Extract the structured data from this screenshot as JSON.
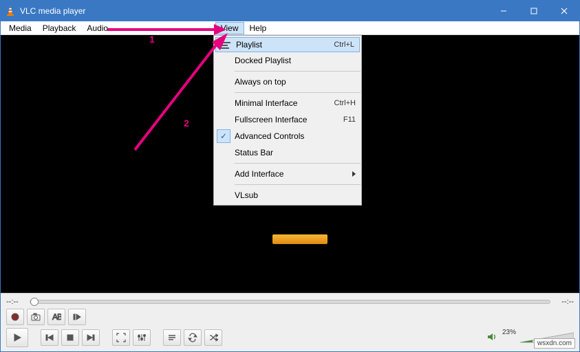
{
  "titlebar": {
    "title": "VLC media player"
  },
  "menu": {
    "media": "Media",
    "playback": "Playback",
    "audio": "Audio",
    "view": "View",
    "help": "Help"
  },
  "view_menu": {
    "playlist": "Playlist",
    "playlist_shortcut": "Ctrl+L",
    "docked_playlist": "Docked Playlist",
    "always_on_top": "Always on top",
    "minimal_interface": "Minimal Interface",
    "minimal_shortcut": "Ctrl+H",
    "fullscreen_interface": "Fullscreen Interface",
    "fullscreen_shortcut": "F11",
    "advanced_controls": "Advanced Controls",
    "status_bar": "Status Bar",
    "add_interface": "Add Interface",
    "vlsub": "VLsub"
  },
  "annotations": {
    "step1": "1",
    "step2": "2"
  },
  "seek": {
    "left_time": "--:--",
    "right_time": "--:--"
  },
  "volume": {
    "percent": "23%"
  },
  "watermark": "wsxdn.com"
}
